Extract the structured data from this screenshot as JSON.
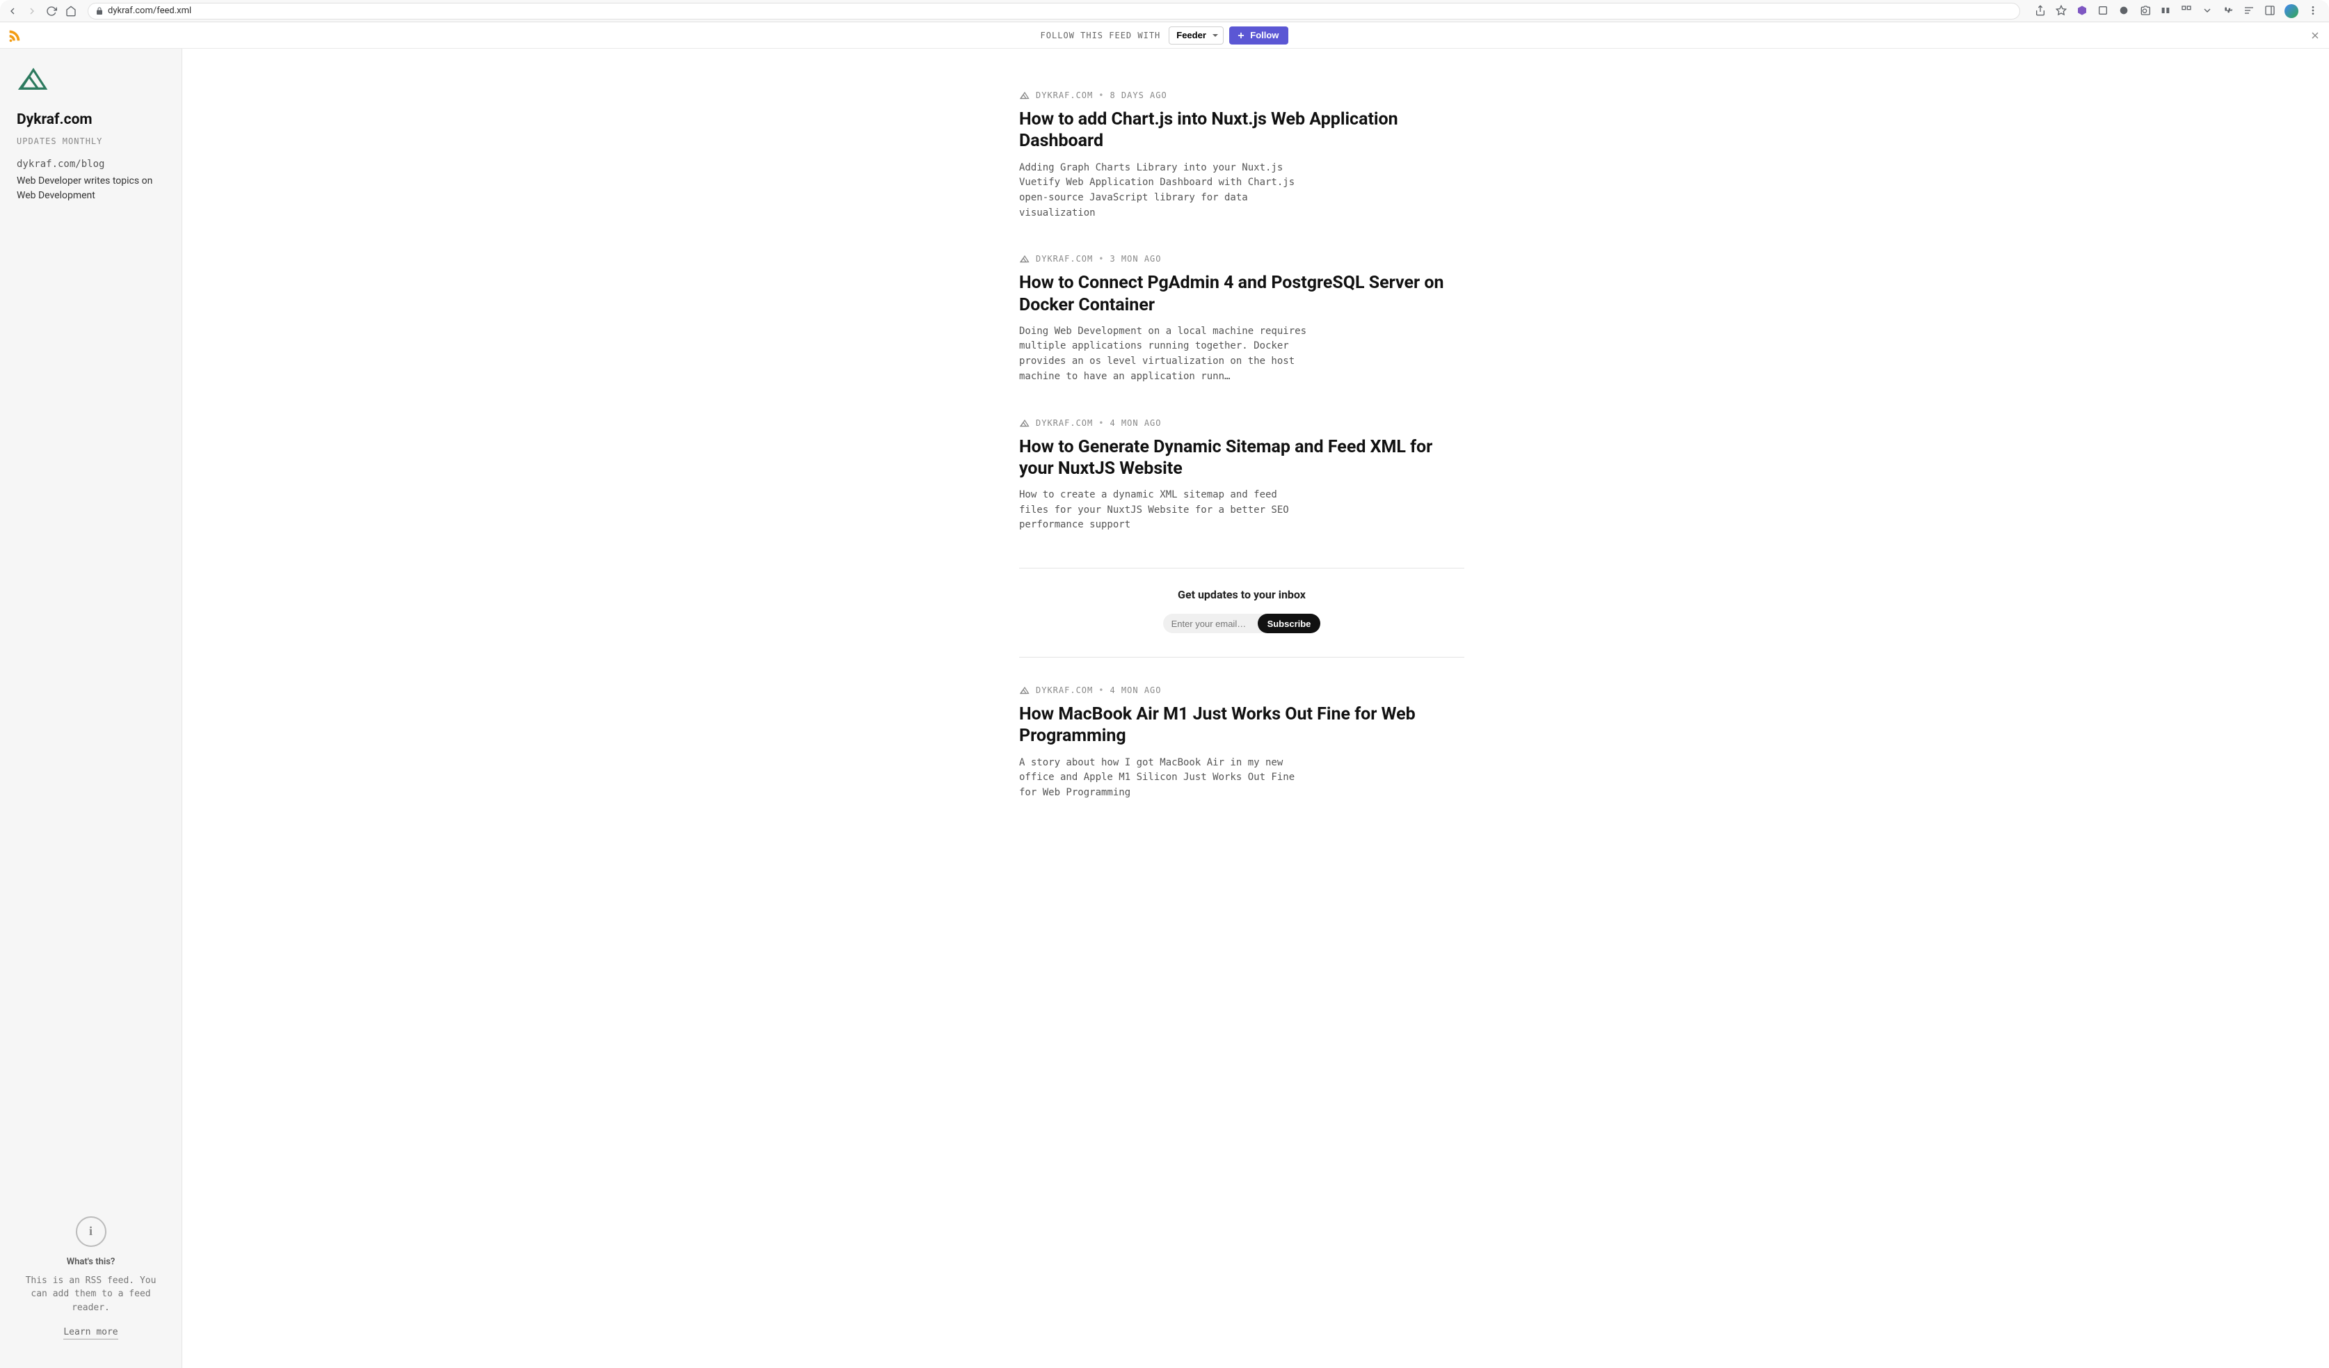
{
  "browser": {
    "url": "dykraf.com/feed.xml"
  },
  "followBar": {
    "label": "FOLLOW THIS FEED WITH",
    "reader": "Feeder",
    "button": "Follow"
  },
  "sidebar": {
    "title": "Dykraf.com",
    "updates": "UPDATES MONTHLY",
    "link": "dykraf.com/blog",
    "description": "Web Developer writes topics on Web Development",
    "info": {
      "heading": "What's this?",
      "text": "This is an RSS feed. You can add them to a feed reader.",
      "learn": "Learn more"
    }
  },
  "articles": [
    {
      "source": "DYKRAF.COM",
      "ago": "8 DAYS AGO",
      "title": "How to add Chart.js into Nuxt.js Web Application Dashboard",
      "excerpt": "Adding Graph Charts Library into your Nuxt.js Vuetify Web Application Dashboard with Chart.js open-source JavaScript library for data visualization"
    },
    {
      "source": "DYKRAF.COM",
      "ago": "3 MON AGO",
      "title": "How to Connect PgAdmin 4 and PostgreSQL Server on Docker Container",
      "excerpt": "Doing Web Development on a local machine requires multiple applications running together. Docker provides an os level virtualization on the host machine to have an application runn…"
    },
    {
      "source": "DYKRAF.COM",
      "ago": "4 MON AGO",
      "title": "How to Generate Dynamic Sitemap and Feed XML for your NuxtJS Website",
      "excerpt": "How to create a dynamic XML sitemap and feed files for your NuxtJS Website for a better SEO performance support"
    },
    {
      "source": "DYKRAF.COM",
      "ago": "4 MON AGO",
      "title": "How MacBook Air M1 Just Works Out Fine for Web Programming",
      "excerpt": "A story about how I got MacBook Air in my new office and Apple M1 Silicon Just Works Out Fine for Web Programming"
    }
  ],
  "subscribe": {
    "title": "Get updates to your inbox",
    "placeholder": "Enter your email…",
    "button": "Subscribe"
  }
}
